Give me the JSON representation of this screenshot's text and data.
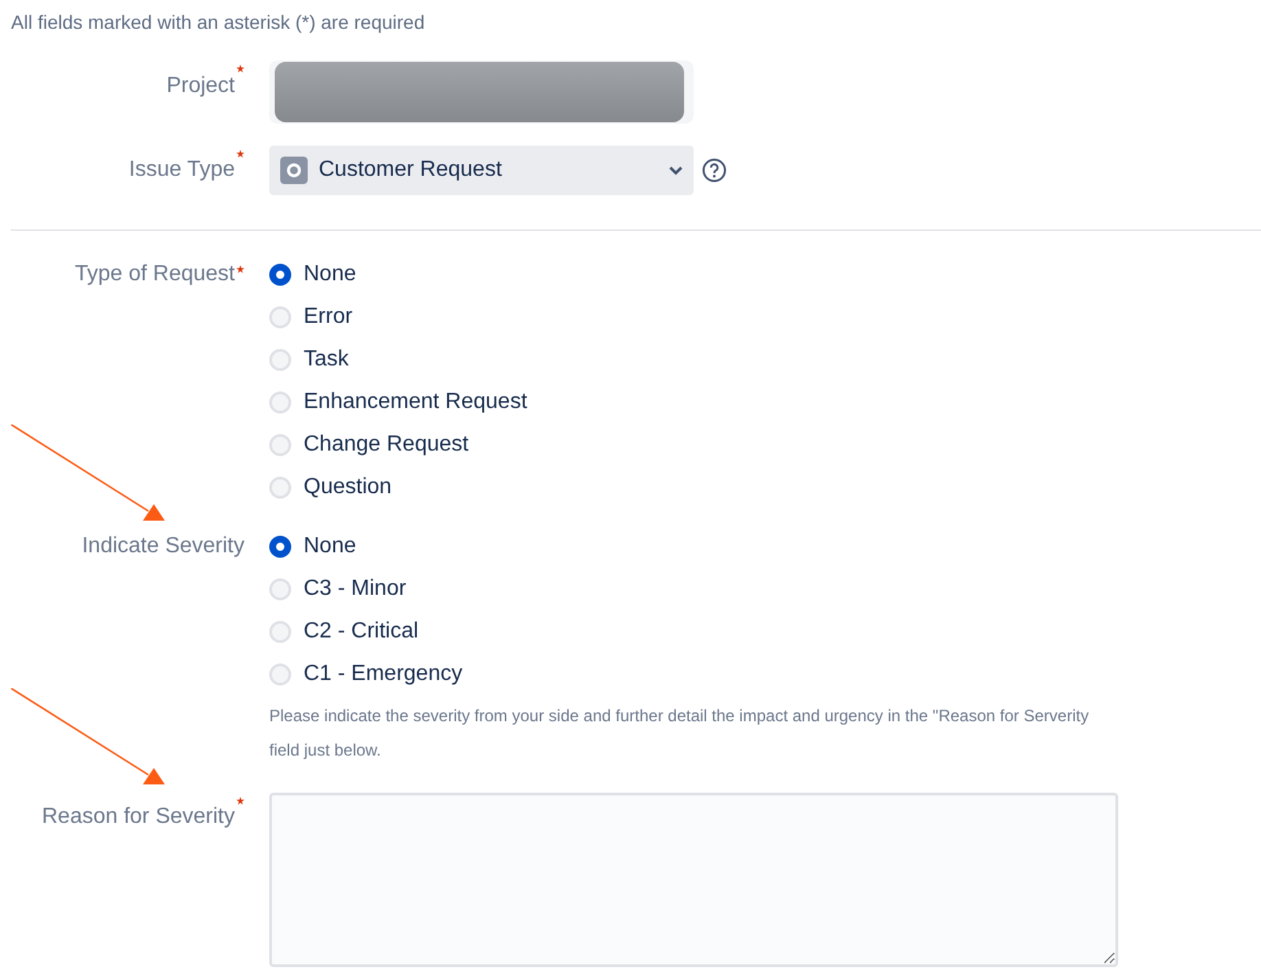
{
  "notice": "All fields marked with an asterisk (*) are required",
  "header_fields": [
    {
      "kind": "redacted",
      "label": "Project",
      "required": true
    },
    {
      "kind": "select",
      "label": "Issue Type",
      "required": true,
      "value": "Customer Request",
      "help": true
    }
  ],
  "fields": [
    {
      "kind": "radio",
      "label": "Type of Request",
      "required": true,
      "options": [
        {
          "label": "None",
          "selected": true
        },
        {
          "label": "Error",
          "selected": false
        },
        {
          "label": "Task",
          "selected": false
        },
        {
          "label": "Enhancement Request",
          "selected": false
        },
        {
          "label": "Change Request",
          "selected": false
        },
        {
          "label": "Question",
          "selected": false
        }
      ]
    },
    {
      "kind": "radio",
      "label": "Indicate Severity",
      "required": false,
      "options": [
        {
          "label": "None",
          "selected": true
        },
        {
          "label": "C3 - Minor",
          "selected": false
        },
        {
          "label": "C2 - Critical",
          "selected": false
        },
        {
          "label": "C1 - Emergency",
          "selected": false
        }
      ],
      "help_lines": [
        "Please indicate the severity from your side and further detail the impact and urgency in the \"Reason for Serverity",
        "field just below."
      ]
    },
    {
      "kind": "textarea",
      "label": "Reason for Severity",
      "required": true
    }
  ],
  "annotations": [
    {
      "kind": "arrow",
      "color": "#fc5b14"
    },
    {
      "kind": "arrow",
      "color": "#fc5b14"
    }
  ]
}
